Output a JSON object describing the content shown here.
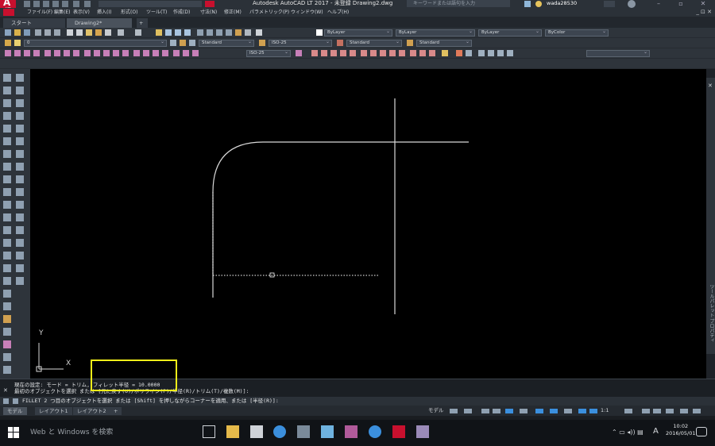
{
  "titlebar": {
    "title": "Autodesk AutoCAD LT 2017 - 未登録   Drawing2.dwg",
    "search_placeholder": "キーワードまたは語句を入力",
    "user": "wada28530",
    "logo_text": "A",
    "logo_sub": "LT"
  },
  "menu": [
    "ファイル(F)",
    "編集(E)",
    "表示(V)",
    "挿入(I)",
    "形式(O)",
    "ツール(T)",
    "作成(D)",
    "寸法(N)",
    "修正(M)",
    "パラメトリック(P)",
    "ウィンドウ(W)",
    "ヘルプ(H)"
  ],
  "mdi_controls": "_ ⊡ ✕",
  "file_tabs": {
    "start": "スタート",
    "drawing": "Drawing2*",
    "add": "+"
  },
  "toolbar2": {
    "layer_name": "0",
    "color": "ByLayer",
    "linetype": "ByLayer",
    "lineweight": "ByLayer",
    "plotstyle": "ByColor"
  },
  "toolbar3": {
    "text_style": "Standard",
    "dim_style": "ISO-25",
    "table_style": "Standard",
    "mleader_style": "Standard"
  },
  "toolbar4": {
    "dim_style": "ISO-25"
  },
  "canvas": {
    "ucs_y": "Y",
    "ucs_x": "X"
  },
  "right_palette_text": "ツールパレット  プロパティ",
  "command_history": [
    "現在の設定: モード = トリム, フィレット半径 = 10.0000",
    "最初のオブジェクトを選択 または [元に戻す(U)/ポリライン(P)/半径(R)/トリム(T)/複数(M)]:"
  ],
  "command_line": "FILLET 2 つ目のオブジェクトを選択 または [Shift] を押しながらコーナーを適用、または [半径(R)]:",
  "layout_tabs": [
    "モデル",
    "レイアウト1",
    "レイアウト2",
    "+"
  ],
  "status": {
    "model": "モデル",
    "scale": "1:1"
  },
  "taskbar": {
    "search": "Web と Windows を検索",
    "time": "10:02",
    "date": "2016/05/01",
    "ime": "A"
  },
  "colors": {
    "canvas_bg": "#000000",
    "highlight": "#f2ef19",
    "ui_dark": "#2e343b",
    "accent_red": "#c8102e"
  }
}
